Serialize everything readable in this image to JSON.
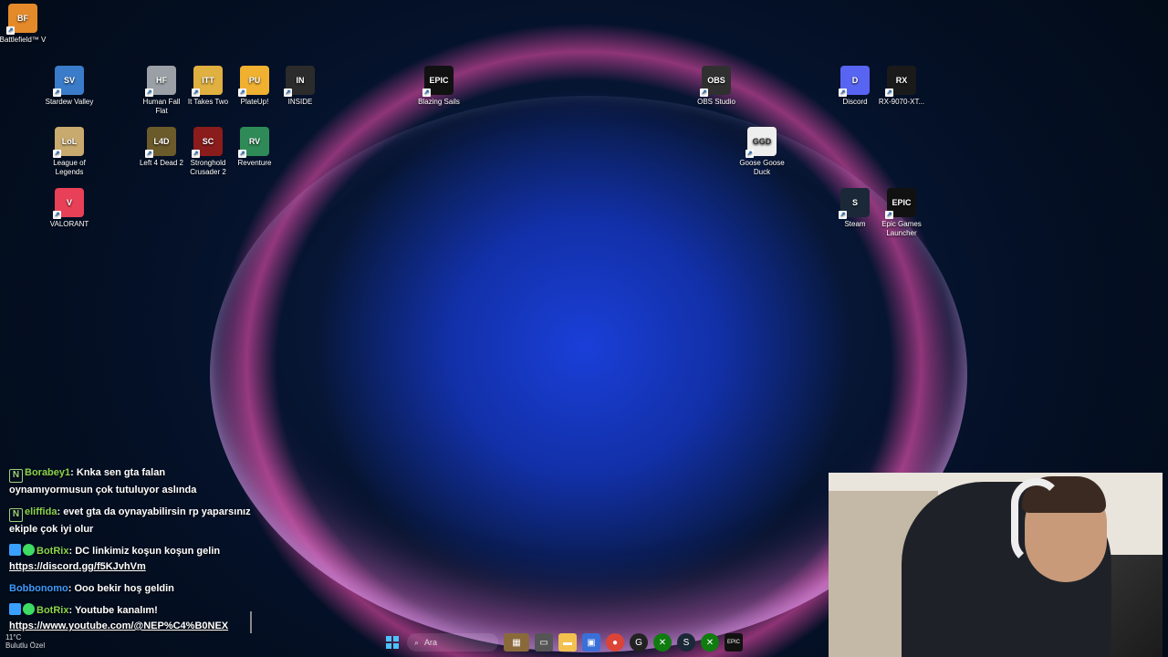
{
  "desktop_icons": [
    {
      "id": "battlefield",
      "label": "Battlefield™ V",
      "color": "#e58a2a",
      "glyph": "BF"
    },
    {
      "id": "stardew",
      "label": "Stardew Valley",
      "color": "#3a7cc9",
      "glyph": "SV"
    },
    {
      "id": "humanfall",
      "label": "Human Fall Flat",
      "color": "#9aa0a6",
      "glyph": "HF"
    },
    {
      "id": "ittakestwo",
      "label": "It Takes Two",
      "color": "#e0b040",
      "glyph": "ITT"
    },
    {
      "id": "plateup",
      "label": "PlateUp!",
      "color": "#f0b030",
      "glyph": "PU"
    },
    {
      "id": "inside",
      "label": "INSIDE",
      "color": "#2b2b2b",
      "glyph": "IN"
    },
    {
      "id": "blazingsails",
      "label": "Blazing Sails",
      "color": "#111111",
      "glyph": "EPIC"
    },
    {
      "id": "obs",
      "label": "OBS Studio",
      "color": "#303030",
      "glyph": "OBS"
    },
    {
      "id": "discord",
      "label": "Discord",
      "color": "#5865f2",
      "glyph": "D"
    },
    {
      "id": "rx9070",
      "label": "RX-9070-XT...",
      "color": "#1a1a1a",
      "glyph": "RX"
    },
    {
      "id": "lol",
      "label": "League of Legends",
      "color": "#c8aa6e",
      "glyph": "LoL"
    },
    {
      "id": "l4d2",
      "label": "Left 4 Dead 2",
      "color": "#6b5a2a",
      "glyph": "L4D"
    },
    {
      "id": "stronghold",
      "label": "Stronghold Crusader 2",
      "color": "#8a1c1c",
      "glyph": "SC"
    },
    {
      "id": "reventure",
      "label": "Reventure",
      "color": "#2e8b57",
      "glyph": "RV"
    },
    {
      "id": "goose",
      "label": "Goose Goose Duck",
      "color": "#eeeeee",
      "glyph": "GGD"
    },
    {
      "id": "valorant",
      "label": "VALORANT",
      "color": "#e84057",
      "glyph": "V"
    },
    {
      "id": "steam",
      "label": "Steam",
      "color": "#1b2838",
      "glyph": "S"
    },
    {
      "id": "epic",
      "label": "Epic Games Launcher",
      "color": "#111111",
      "glyph": "EPIC"
    }
  ],
  "chat": [
    {
      "badge": "n",
      "user": "Borabey1",
      "user_class": "green",
      "text": "Knka sen gta falan oynamıyormusun çok tutuluyor aslında"
    },
    {
      "badge": "n",
      "user": "eliffida",
      "user_class": "green",
      "text": "evet gta da oynayabilirsin rp yaparsınız ekiple çok iyi olur"
    },
    {
      "badge": "bot",
      "user": "BotRix",
      "user_class": "green",
      "text": "DC linkimiz koşun koşun gelin",
      "link": "https://discord.gg/f5KJvhVm"
    },
    {
      "badge": "",
      "user": "Bobbonomo",
      "user_class": "blue",
      "text": "Ooo bekir hoş geldin"
    },
    {
      "badge": "bot",
      "user": "BotRix",
      "user_class": "green",
      "text": "Youtube kanalım!",
      "link": "https://www.youtube.com/@NEP%C4%B0NEX"
    }
  ],
  "weather": {
    "temp": "11°C",
    "desc": "Bulutlu Özel"
  },
  "taskbar": {
    "search_placeholder": "Ara"
  }
}
